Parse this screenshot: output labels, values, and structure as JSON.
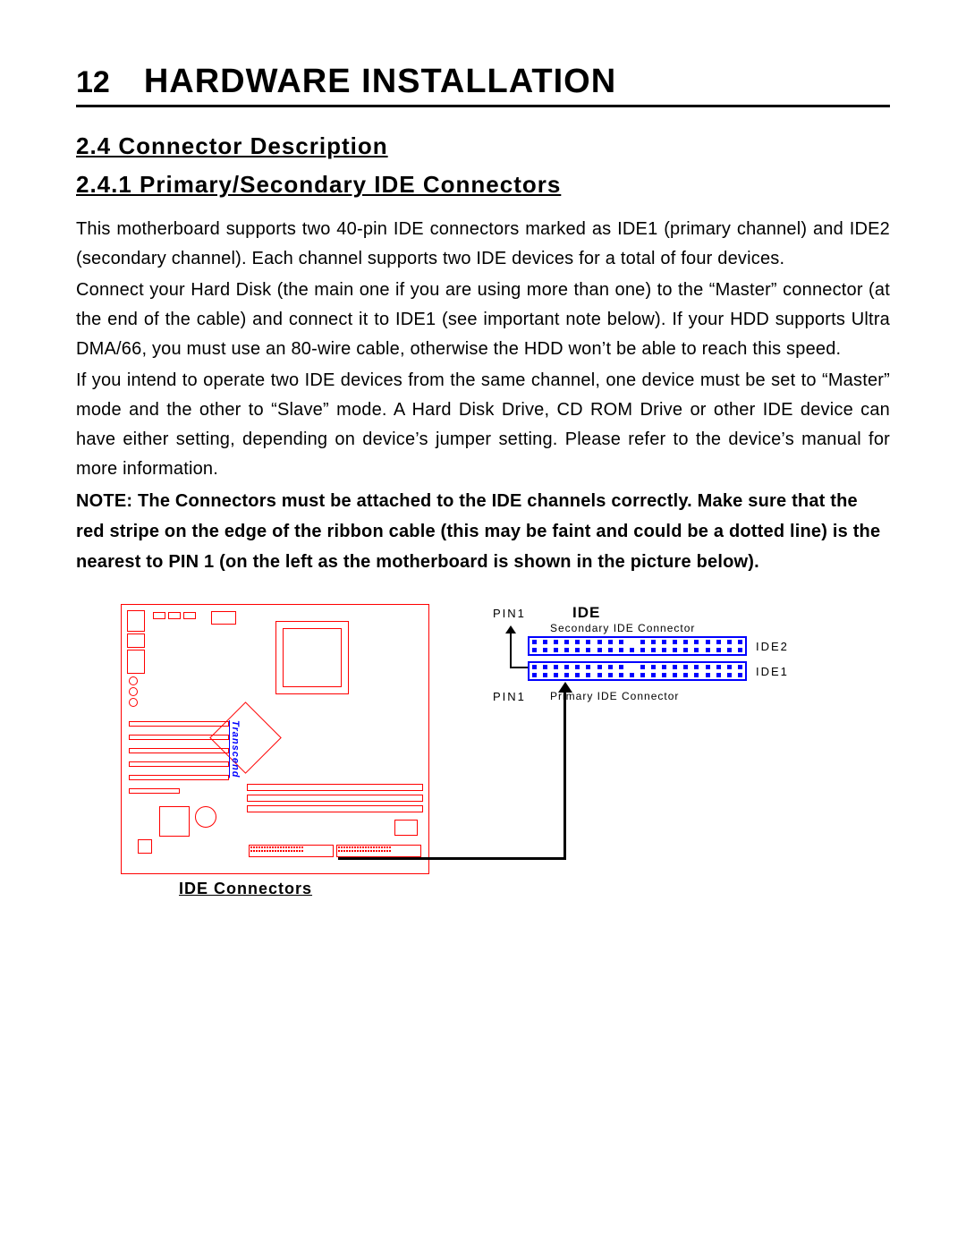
{
  "page_number": "12",
  "chapter_title": "HARDWARE INSTALLATION",
  "h2": "2.4  Connector  Description",
  "h3": "2.4.1  Primary/Secondary  IDE  Connectors",
  "para1": "This motherboard supports two 40-pin IDE connectors marked as IDE1 (primary channel) and IDE2 (secondary channel).  Each channel supports two IDE devices for a total of four devices.",
  "para2": "Connect your Hard Disk (the main one if you are using more than one) to the “Master” connector (at the end of the cable) and connect it to IDE1 (see important note below).  If your HDD supports Ultra DMA/66, you must use an 80-wire cable, otherwise the HDD won’t be able to reach this speed.",
  "para3": "If you intend to operate two IDE devices from the same channel, one device must be set to “Master” mode and the other to “Slave” mode.  A Hard Disk Drive, CD ROM Drive or other IDE device can have either setting, depending on device’s jumper setting.  Please refer to the device’s manual for more information.",
  "note_lead": "NOTE:  ",
  "note_body": "The Connectors must be attached to the IDE channels correctly.  Make sure that the red stripe on the edge of the ribbon cable (this may be faint and could be a dotted line) is the nearest to PIN 1 (on the left as the motherboard is shown in the  picture below).",
  "diagram": {
    "brand": "Transcend",
    "caption": "IDE Connectors",
    "ide_title": "IDE",
    "pin1": "PIN1",
    "secondary_label": "Secondary IDE Connector",
    "primary_label": "Primary IDE Connector",
    "ide1": "IDE1",
    "ide2": "IDE2"
  }
}
